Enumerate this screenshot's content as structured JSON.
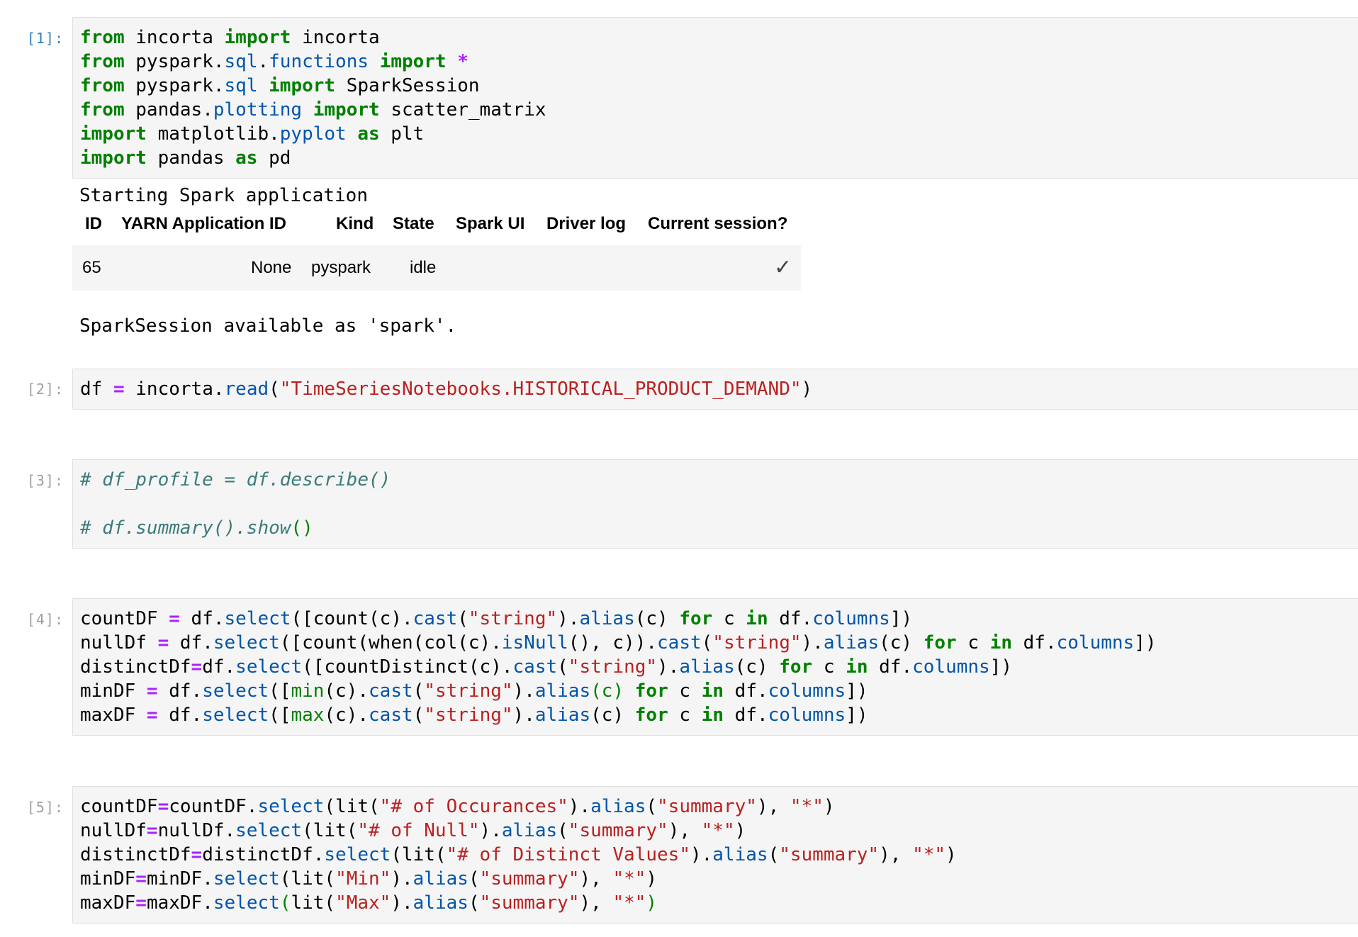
{
  "cells": [
    {
      "prompt": "[1]:",
      "lines": [
        [
          [
            "kw",
            "from"
          ],
          [
            "t",
            " incorta "
          ],
          [
            "kw",
            "import"
          ],
          [
            "t",
            " incorta"
          ]
        ],
        [
          [
            "kw",
            "from"
          ],
          [
            "t",
            " pyspark."
          ],
          [
            "attr",
            "sql"
          ],
          [
            "t",
            "."
          ],
          [
            "attr",
            "functions"
          ],
          [
            "t",
            " "
          ],
          [
            "kw",
            "import"
          ],
          [
            "t",
            " "
          ],
          [
            "op",
            "*"
          ]
        ],
        [
          [
            "kw",
            "from"
          ],
          [
            "t",
            " pyspark."
          ],
          [
            "attr",
            "sql"
          ],
          [
            "t",
            " "
          ],
          [
            "kw",
            "import"
          ],
          [
            "t",
            " SparkSession"
          ]
        ],
        [
          [
            "kw",
            "from"
          ],
          [
            "t",
            " pandas."
          ],
          [
            "attr",
            "plotting"
          ],
          [
            "t",
            " "
          ],
          [
            "kw",
            "import"
          ],
          [
            "t",
            " scatter_matrix"
          ]
        ],
        [
          [
            "kw",
            "import"
          ],
          [
            "t",
            " matplotlib."
          ],
          [
            "attr",
            "pyplot"
          ],
          [
            "t",
            " "
          ],
          [
            "kw",
            "as"
          ],
          [
            "t",
            " plt"
          ]
        ],
        [
          [
            "kw",
            "import"
          ],
          [
            "t",
            " pandas "
          ],
          [
            "kw",
            "as"
          ],
          [
            "t",
            " pd"
          ]
        ]
      ]
    },
    {
      "prompt": "[2]:",
      "lines": [
        [
          [
            "t",
            "df "
          ],
          [
            "op",
            "="
          ],
          [
            "t",
            " incorta."
          ],
          [
            "attr",
            "read"
          ],
          [
            "t",
            "("
          ],
          [
            "str",
            "\"TimeSeriesNotebooks.HISTORICAL_PRODUCT_DEMAND\""
          ],
          [
            "t",
            ")"
          ]
        ]
      ]
    },
    {
      "prompt": "[3]:",
      "lines": [
        [
          [
            "cmt",
            "# df_profile = df.describe()"
          ]
        ],
        [
          [
            "t",
            ""
          ]
        ],
        [
          [
            "cmt",
            "# df.summary().show"
          ],
          [
            "grn",
            "()"
          ]
        ]
      ]
    },
    {
      "prompt": "[4]:",
      "lines": [
        [
          [
            "t",
            "countDF "
          ],
          [
            "op",
            "="
          ],
          [
            "t",
            " df."
          ],
          [
            "attr",
            "select"
          ],
          [
            "t",
            "([count(c)."
          ],
          [
            "attr",
            "cast"
          ],
          [
            "t",
            "("
          ],
          [
            "str",
            "\"string\""
          ],
          [
            "t",
            ")."
          ],
          [
            "attr",
            "alias"
          ],
          [
            "t",
            "(c) "
          ],
          [
            "kw",
            "for"
          ],
          [
            "t",
            " c "
          ],
          [
            "kw",
            "in"
          ],
          [
            "t",
            " df."
          ],
          [
            "attr",
            "columns"
          ],
          [
            "t",
            "])"
          ]
        ],
        [
          [
            "t",
            "nullDf "
          ],
          [
            "op",
            "="
          ],
          [
            "t",
            " df."
          ],
          [
            "attr",
            "select"
          ],
          [
            "t",
            "([count(when(col(c)."
          ],
          [
            "attr",
            "isNull"
          ],
          [
            "t",
            "(), c))."
          ],
          [
            "attr",
            "cast"
          ],
          [
            "t",
            "("
          ],
          [
            "str",
            "\"string\""
          ],
          [
            "t",
            ")."
          ],
          [
            "attr",
            "alias"
          ],
          [
            "t",
            "(c) "
          ],
          [
            "kw",
            "for"
          ],
          [
            "t",
            " c "
          ],
          [
            "kw",
            "in"
          ],
          [
            "t",
            " df."
          ],
          [
            "attr",
            "columns"
          ],
          [
            "t",
            "])"
          ]
        ],
        [
          [
            "t",
            "distinctDf"
          ],
          [
            "op",
            "="
          ],
          [
            "t",
            "df."
          ],
          [
            "attr",
            "select"
          ],
          [
            "t",
            "([countDistinct(c)."
          ],
          [
            "attr",
            "cast"
          ],
          [
            "t",
            "("
          ],
          [
            "str",
            "\"string\""
          ],
          [
            "t",
            ")."
          ],
          [
            "attr",
            "alias"
          ],
          [
            "t",
            "(c) "
          ],
          [
            "kw",
            "for"
          ],
          [
            "t",
            " c "
          ],
          [
            "kw",
            "in"
          ],
          [
            "t",
            " df."
          ],
          [
            "attr",
            "columns"
          ],
          [
            "t",
            "])"
          ]
        ],
        [
          [
            "t",
            "minDF "
          ],
          [
            "op",
            "="
          ],
          [
            "t",
            " df."
          ],
          [
            "attr",
            "select"
          ],
          [
            "t",
            "(["
          ],
          [
            "grn",
            "min"
          ],
          [
            "t",
            "(c)."
          ],
          [
            "attr",
            "cast"
          ],
          [
            "t",
            "("
          ],
          [
            "str",
            "\"string\""
          ],
          [
            "t",
            ")."
          ],
          [
            "attr",
            "alias"
          ],
          [
            "grn",
            "(c)"
          ],
          [
            "t",
            " "
          ],
          [
            "kw",
            "for"
          ],
          [
            "t",
            " c "
          ],
          [
            "kw",
            "in"
          ],
          [
            "t",
            " df."
          ],
          [
            "attr",
            "columns"
          ],
          [
            "t",
            "])"
          ]
        ],
        [
          [
            "t",
            "maxDF "
          ],
          [
            "op",
            "="
          ],
          [
            "t",
            " df."
          ],
          [
            "attr",
            "select"
          ],
          [
            "t",
            "(["
          ],
          [
            "grn",
            "max"
          ],
          [
            "t",
            "(c)."
          ],
          [
            "attr",
            "cast"
          ],
          [
            "t",
            "("
          ],
          [
            "str",
            "\"string\""
          ],
          [
            "t",
            ")."
          ],
          [
            "attr",
            "alias"
          ],
          [
            "t",
            "(c) "
          ],
          [
            "kw",
            "for"
          ],
          [
            "t",
            " c "
          ],
          [
            "kw",
            "in"
          ],
          [
            "t",
            " df."
          ],
          [
            "attr",
            "columns"
          ],
          [
            "t",
            "])"
          ]
        ]
      ]
    },
    {
      "prompt": "[5]:",
      "lines": [
        [
          [
            "t",
            "countDF"
          ],
          [
            "op",
            "="
          ],
          [
            "t",
            "countDF."
          ],
          [
            "attr",
            "select"
          ],
          [
            "t",
            "(lit("
          ],
          [
            "str",
            "\"# of Occurances\""
          ],
          [
            "t",
            ")."
          ],
          [
            "attr",
            "alias"
          ],
          [
            "t",
            "("
          ],
          [
            "str",
            "\"summary\""
          ],
          [
            "t",
            "), "
          ],
          [
            "str",
            "\"*\""
          ],
          [
            "t",
            ")"
          ]
        ],
        [
          [
            "t",
            "nullDf"
          ],
          [
            "op",
            "="
          ],
          [
            "t",
            "nullDf."
          ],
          [
            "attr",
            "select"
          ],
          [
            "t",
            "(lit("
          ],
          [
            "str",
            "\"# of Null\""
          ],
          [
            "t",
            ")."
          ],
          [
            "attr",
            "alias"
          ],
          [
            "t",
            "("
          ],
          [
            "str",
            "\"summary\""
          ],
          [
            "t",
            "), "
          ],
          [
            "str",
            "\"*\""
          ],
          [
            "t",
            ")"
          ]
        ],
        [
          [
            "t",
            "distinctDf"
          ],
          [
            "op",
            "="
          ],
          [
            "t",
            "distinctDf."
          ],
          [
            "attr",
            "select"
          ],
          [
            "t",
            "(lit("
          ],
          [
            "str",
            "\"# of Distinct Values\""
          ],
          [
            "t",
            ")."
          ],
          [
            "attr",
            "alias"
          ],
          [
            "t",
            "("
          ],
          [
            "str",
            "\"summary\""
          ],
          [
            "t",
            "), "
          ],
          [
            "str",
            "\"*\""
          ],
          [
            "t",
            ")"
          ]
        ],
        [
          [
            "t",
            "minDF"
          ],
          [
            "op",
            "="
          ],
          [
            "t",
            "minDF."
          ],
          [
            "attr",
            "select"
          ],
          [
            "t",
            "(lit("
          ],
          [
            "str",
            "\"Min\""
          ],
          [
            "t",
            ")."
          ],
          [
            "attr",
            "alias"
          ],
          [
            "t",
            "("
          ],
          [
            "str",
            "\"summary\""
          ],
          [
            "t",
            "), "
          ],
          [
            "str",
            "\"*\""
          ],
          [
            "t",
            ")"
          ]
        ],
        [
          [
            "t",
            "maxDF"
          ],
          [
            "op",
            "="
          ],
          [
            "t",
            "maxDF."
          ],
          [
            "attr",
            "select"
          ],
          [
            "grn",
            "("
          ],
          [
            "t",
            "lit("
          ],
          [
            "str",
            "\"Max\""
          ],
          [
            "t",
            ")."
          ],
          [
            "attr",
            "alias"
          ],
          [
            "t",
            "("
          ],
          [
            "str",
            "\"summary\""
          ],
          [
            "t",
            "), "
          ],
          [
            "str",
            "\"*\""
          ],
          [
            "grn",
            ")"
          ]
        ]
      ]
    }
  ],
  "output1": {
    "starting_text": "Starting Spark application",
    "table": {
      "headers": [
        "ID",
        "YARN Application ID",
        "Kind",
        "State",
        "Spark UI",
        "Driver log",
        "Current session?"
      ],
      "row": {
        "id": "65",
        "yarn_app_id": "None",
        "kind": "pyspark",
        "state": "idle",
        "current_session_icon": "check-icon",
        "check_glyph": "✓"
      }
    },
    "session_text": "SparkSession available as 'spark'."
  }
}
